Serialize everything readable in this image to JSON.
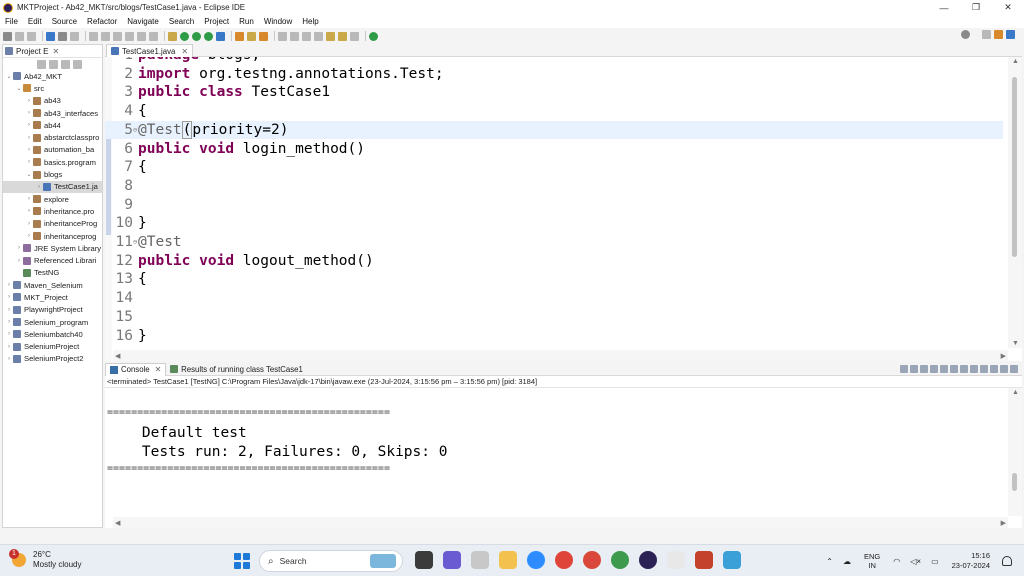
{
  "window": {
    "title": "MKTProject - Ab42_MKT/src/blogs/TestCase1.java - Eclipse IDE",
    "minimize": "—",
    "maximize": "❐",
    "close": "✕"
  },
  "menu": [
    "File",
    "Edit",
    "Source",
    "Refactor",
    "Navigate",
    "Search",
    "Project",
    "Run",
    "Window",
    "Help"
  ],
  "explorer": {
    "tab_label": "Project E",
    "close": "✕",
    "tree": [
      {
        "label": "Ab42_MKT",
        "level": 0,
        "icon": "project-icon",
        "expanded": true
      },
      {
        "label": "src",
        "level": 1,
        "icon": "source-folder-icon",
        "expanded": true
      },
      {
        "label": "ab43",
        "level": 2,
        "icon": "package-icon",
        "expanded": false
      },
      {
        "label": "ab43_interfaces",
        "level": 2,
        "icon": "package-icon",
        "expanded": false
      },
      {
        "label": "ab44",
        "level": 2,
        "icon": "package-icon",
        "expanded": false
      },
      {
        "label": "abstarctclasspro",
        "level": 2,
        "icon": "package-icon",
        "expanded": false
      },
      {
        "label": "automation_ba",
        "level": 2,
        "icon": "package-icon",
        "expanded": false
      },
      {
        "label": "basics.program",
        "level": 2,
        "icon": "package-icon",
        "expanded": false
      },
      {
        "label": "blogs",
        "level": 2,
        "icon": "package-icon",
        "expanded": true
      },
      {
        "label": "TestCase1.ja",
        "level": 3,
        "icon": "java-file-icon",
        "expanded": false,
        "selected": true
      },
      {
        "label": "explore",
        "level": 2,
        "icon": "package-icon",
        "expanded": false
      },
      {
        "label": "inheritance.pro",
        "level": 2,
        "icon": "package-icon",
        "expanded": false
      },
      {
        "label": "inheritanceProg",
        "level": 2,
        "icon": "package-icon",
        "expanded": false
      },
      {
        "label": "inheritanceprog",
        "level": 2,
        "icon": "package-icon",
        "expanded": false
      },
      {
        "label": "JRE System Library",
        "level": 1,
        "icon": "library-icon",
        "expanded": false
      },
      {
        "label": "Referenced Librari",
        "level": 1,
        "icon": "library-icon",
        "expanded": false
      },
      {
        "label": "TestNG",
        "level": 1,
        "icon": "testng-icon",
        "expanded": false,
        "no_twisty": true
      },
      {
        "label": "Maven_Selenium",
        "level": 0,
        "icon": "project-icon",
        "expanded": false
      },
      {
        "label": "MKT_Project",
        "level": 0,
        "icon": "project-icon",
        "expanded": false
      },
      {
        "label": "PlaywrightProject",
        "level": 0,
        "icon": "project-icon",
        "expanded": false
      },
      {
        "label": "Selenium_program",
        "level": 0,
        "icon": "project-icon",
        "expanded": false
      },
      {
        "label": "Seleniumbatch40",
        "level": 0,
        "icon": "project-icon",
        "expanded": false
      },
      {
        "label": "SeleniumProject",
        "level": 0,
        "icon": "project-icon",
        "expanded": false
      },
      {
        "label": "SeleniumProject2",
        "level": 0,
        "icon": "project-icon",
        "expanded": false
      }
    ]
  },
  "editor": {
    "tab_label": "TestCase1.java",
    "close": "✕",
    "lines": [
      {
        "num": "1",
        "parts": [
          {
            "t": "package",
            "k": "kw"
          },
          {
            "t": " blogs;"
          }
        ]
      },
      {
        "num": "2",
        "parts": [
          {
            "t": "import",
            "k": "kw"
          },
          {
            "t": " org.testng.annotations.Test;"
          }
        ]
      },
      {
        "num": "3",
        "parts": [
          {
            "t": "public",
            "k": "kw"
          },
          {
            "t": " "
          },
          {
            "t": "class",
            "k": "kw"
          },
          {
            "t": " TestCase1"
          }
        ]
      },
      {
        "num": "4",
        "parts": [
          {
            "t": "{"
          }
        ]
      },
      {
        "num": "5",
        "fold": true,
        "active": true,
        "parts": [
          {
            "t": "@Test",
            "k": "ann"
          },
          {
            "t": "(",
            "k": "box"
          },
          {
            "t": "priority=2)"
          }
        ]
      },
      {
        "num": "6",
        "parts": [
          {
            "t": "public",
            "k": "kw"
          },
          {
            "t": " "
          },
          {
            "t": "void",
            "k": "kw"
          },
          {
            "t": " login_method()"
          }
        ]
      },
      {
        "num": "7",
        "parts": [
          {
            "t": "{"
          }
        ]
      },
      {
        "num": "8",
        "parts": []
      },
      {
        "num": "9",
        "parts": []
      },
      {
        "num": "10",
        "parts": [
          {
            "t": "}"
          }
        ]
      },
      {
        "num": "11",
        "fold": true,
        "parts": [
          {
            "t": "@Test",
            "k": "ann"
          }
        ]
      },
      {
        "num": "12",
        "parts": [
          {
            "t": "public",
            "k": "kw"
          },
          {
            "t": " "
          },
          {
            "t": "void",
            "k": "kw"
          },
          {
            "t": " logout_method()"
          }
        ]
      },
      {
        "num": "13",
        "parts": [
          {
            "t": "{"
          }
        ]
      },
      {
        "num": "14",
        "parts": []
      },
      {
        "num": "15",
        "parts": []
      },
      {
        "num": "16",
        "parts": [
          {
            "t": "}"
          }
        ]
      }
    ]
  },
  "console": {
    "tab_console": "Console",
    "tab_results": "Results of running class TestCase1",
    "close": "✕",
    "status": "<terminated> TestCase1 [TestNG] C:\\Program Files\\Java\\jdk-17\\bin\\javaw.exe  (23-Jul-2024, 3:15:56 pm – 3:15:56 pm) [pid: 3184]",
    "separator": "===============================================",
    "output_1": "    Default test",
    "output_2": "    Tests run: 2, Failures: 0, Skips: 0"
  },
  "taskbar": {
    "weather_badge": "1",
    "temperature": "26°C",
    "weather_desc": "Mostly cloudy",
    "search_label": "Search",
    "language_1": "ENG",
    "language_2": "IN",
    "time": "15:16",
    "date": "23-07-2024"
  },
  "colors": {
    "keyword": "#7f0055",
    "annotation": "#646464",
    "active_line": "#e8f2fe",
    "accent": "#1e7ad6"
  }
}
